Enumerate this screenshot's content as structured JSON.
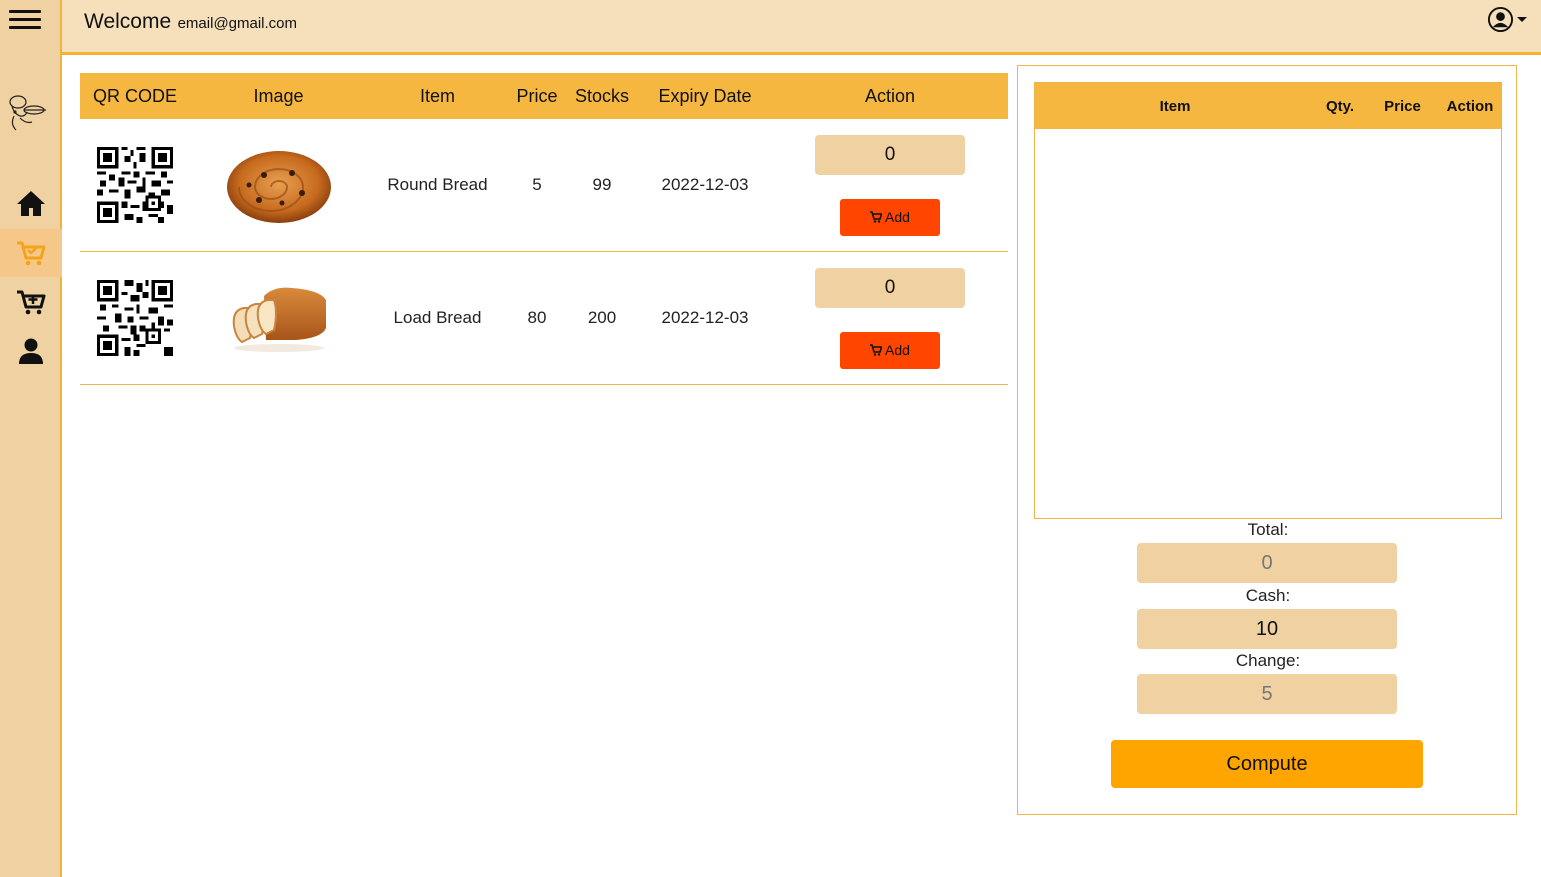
{
  "header": {
    "welcome": "Welcome",
    "email": "email@gmail.com",
    "user_icon": "user-circle-icon"
  },
  "sidebar": {
    "items": [
      {
        "icon": "home-icon",
        "active": false
      },
      {
        "icon": "cart-check-icon",
        "active": true
      },
      {
        "icon": "cart-plus-icon",
        "active": false
      },
      {
        "icon": "user-icon",
        "active": false
      }
    ],
    "accent": "#f5b73f"
  },
  "products": {
    "columns": [
      "QR CODE",
      "Image",
      "Item",
      "Price",
      "Stocks",
      "Expiry Date",
      "Action"
    ],
    "rows": [
      {
        "item": "Round Bread",
        "price": "5",
        "stocks": "99",
        "expiry": "2022-12-03",
        "qty": "0",
        "add_label": "Add"
      },
      {
        "item": "Load Bread",
        "price": "80",
        "stocks": "200",
        "expiry": "2022-12-03",
        "qty": "0",
        "add_label": "Add"
      }
    ]
  },
  "cart": {
    "columns": [
      "Item",
      "Qty.",
      "Price",
      "Action"
    ],
    "total_label": "Total:",
    "total_value": "0",
    "cash_label": "Cash:",
    "cash_value": "10",
    "change_label": "Change:",
    "change_value": "5",
    "compute_label": "Compute"
  },
  "colors": {
    "header_bg": "#f6e0bc",
    "table_header": "#f5b73f",
    "add_button": "#ff4500",
    "compute_button": "#ffa500",
    "input_bg": "#f0d1a2"
  }
}
